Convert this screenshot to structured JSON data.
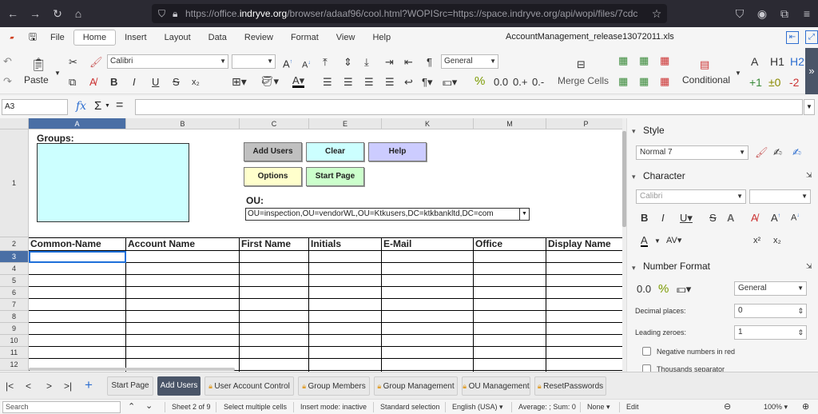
{
  "browser": {
    "url_prefix": "https://office.",
    "url_domain": "indryve.org",
    "url_rest": "/browser/adaaf96/cool.html?WOPISrc=https://space.indryve.org/api/wopi/files/7cdc"
  },
  "menu": {
    "items": [
      "File",
      "Home",
      "Insert",
      "Layout",
      "Data",
      "Review",
      "Format",
      "View",
      "Help"
    ],
    "active": "Home",
    "doc_title": "AccountManagement_release13072011.xls"
  },
  "toolbar": {
    "paste": "Paste",
    "font_name": "Calibri",
    "font_size": "",
    "number_format": "General",
    "merge_cells": "Merge Cells",
    "conditional": "Conditional",
    "bold": "B",
    "italic": "I",
    "underline": "U",
    "strike": "S",
    "subscript": "x₂",
    "percent": "%",
    "decimal": "0.0",
    "add_decimal": "0.+",
    "remove_decimal": "0.-",
    "style_a": "A",
    "style_h1": "H1",
    "style_h2": "H2",
    "style_p1": "+1",
    "style_0": "±0",
    "style_m2": "-2"
  },
  "formula": {
    "name_box": "A3",
    "fx": "fx",
    "sum": "Σ",
    "eq": "="
  },
  "columns": [
    {
      "label": "A",
      "sel": true
    },
    {
      "label": "B",
      "sel": false
    },
    {
      "label": "C",
      "sel": false
    },
    {
      "label": "E",
      "sel": false
    },
    {
      "label": "K",
      "sel": false
    },
    {
      "label": "M",
      "sel": false
    },
    {
      "label": "P",
      "sel": false
    }
  ],
  "rows": [
    "1",
    "2",
    "3",
    "4",
    "5",
    "6",
    "7",
    "8",
    "9",
    "10",
    "11",
    "12"
  ],
  "sheet": {
    "groups_label": "Groups:",
    "buttons": {
      "add_users": "Add Users",
      "clear": "Clear",
      "help": "Help",
      "options": "Options",
      "start_page": "Start Page"
    },
    "ou_label": "OU:",
    "ou_value": "OU=inspection,OU=vendorWL,OU=Ktkusers,DC=ktkbankltd,DC=com",
    "headers": [
      "Common-Name",
      "Account Name",
      "First Name",
      "Initials",
      "E-Mail",
      "Office",
      "Display Name"
    ]
  },
  "sidebar": {
    "style_title": "Style",
    "style_value": "Normal 7",
    "character_title": "Character",
    "font_value": "Calibri",
    "size_value": "",
    "number_format_title": "Number Format",
    "number_format_value": "General",
    "decimal_places_label": "Decimal places:",
    "decimal_places_value": "0",
    "leading_zeroes_label": "Leading zeroes:",
    "leading_zeroes_value": "1",
    "negative_red_label": "Negative numbers in red",
    "thousands_sep_label": "Thousands separator",
    "superscript": "x²",
    "subscript": "x₂",
    "percent": "%",
    "decimal": "0.0"
  },
  "tabs": [
    {
      "label": "Start Page",
      "active": false,
      "locked": false
    },
    {
      "label": "Add Users",
      "active": true,
      "locked": false
    },
    {
      "label": "User Account Control",
      "active": false,
      "locked": true
    },
    {
      "label": "Group Members",
      "active": false,
      "locked": true
    },
    {
      "label": "Group Management",
      "active": false,
      "locked": true
    },
    {
      "label": "OU Management",
      "active": false,
      "locked": true
    },
    {
      "label": "ResetPasswords",
      "active": false,
      "locked": true
    }
  ],
  "status": {
    "search_placeholder": "Search",
    "sheet_info": "Sheet 2 of 9",
    "select_mode": "Select multiple cells",
    "insert_mode": "Insert mode: inactive",
    "selection": "Standard selection",
    "language": "English (USA)",
    "calc": "Average: ; Sum: 0",
    "none": "None",
    "edit": "Edit",
    "zoom": "100%"
  }
}
